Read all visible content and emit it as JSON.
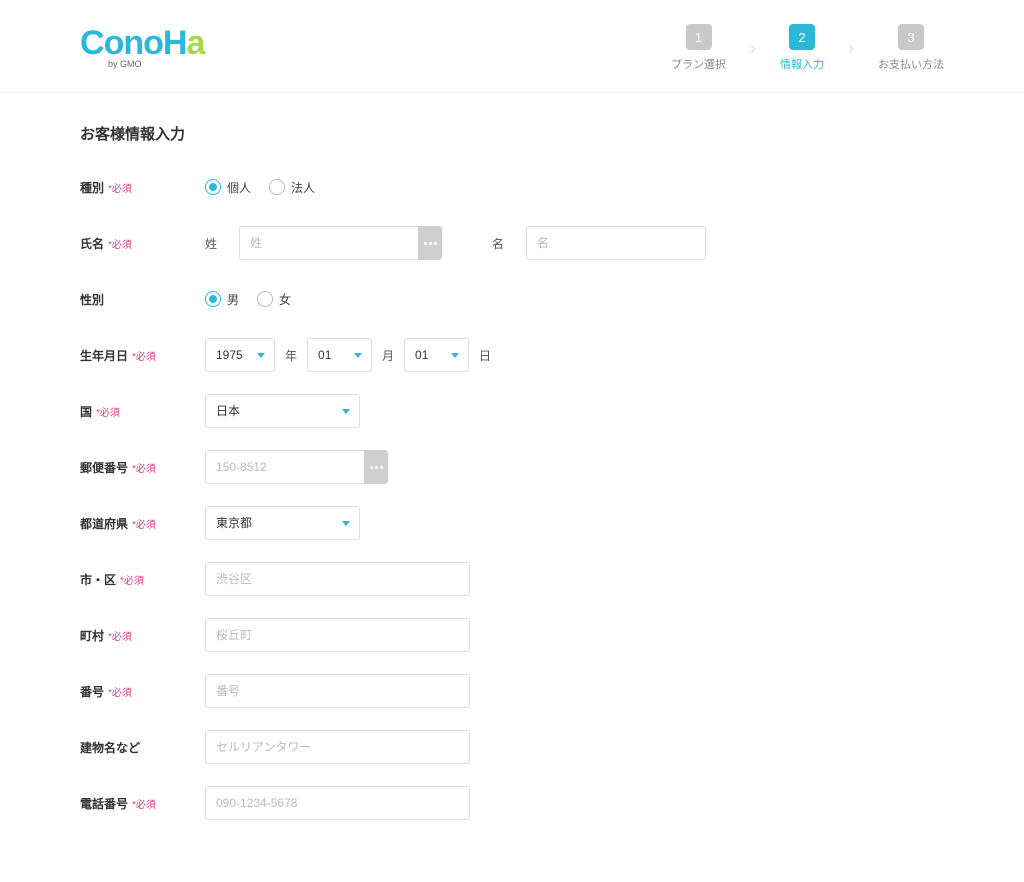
{
  "logo": {
    "text_c": "C",
    "text_ono": "ono",
    "text_h": "H",
    "text_a": "a",
    "sub": "by GMO"
  },
  "steps": [
    {
      "num": "1",
      "label": "プラン選択",
      "active": false
    },
    {
      "num": "2",
      "label": "情報入力",
      "active": true
    },
    {
      "num": "3",
      "label": "お支払い方法",
      "active": false
    }
  ],
  "page_title": "お客様情報入力",
  "required_text": "*必須",
  "labels": {
    "type": "種別",
    "name": "氏名",
    "gender": "性別",
    "birthdate": "生年月日",
    "country": "国",
    "postal": "郵便番号",
    "prefecture": "都道府県",
    "city": "市・区",
    "town": "町村",
    "street": "番号",
    "building": "建物名など",
    "phone": "電話番号"
  },
  "type_options": {
    "individual": "個人",
    "corporate": "法人"
  },
  "name_fields": {
    "lastname_label": "姓",
    "lastname_placeholder": "姓",
    "firstname_label": "名",
    "firstname_placeholder": "名"
  },
  "gender_options": {
    "male": "男",
    "female": "女"
  },
  "birthdate": {
    "year": "1975",
    "year_unit": "年",
    "month": "01",
    "month_unit": "月",
    "day": "01",
    "day_unit": "日"
  },
  "country": {
    "value": "日本"
  },
  "postal": {
    "placeholder": "150-8512"
  },
  "prefecture": {
    "value": "東京都"
  },
  "city": {
    "placeholder": "渋谷区"
  },
  "town": {
    "placeholder": "桜丘町"
  },
  "street": {
    "placeholder": "番号"
  },
  "building": {
    "placeholder": "セルリアンタワー"
  },
  "phone": {
    "placeholder": "090-1234-5678"
  }
}
